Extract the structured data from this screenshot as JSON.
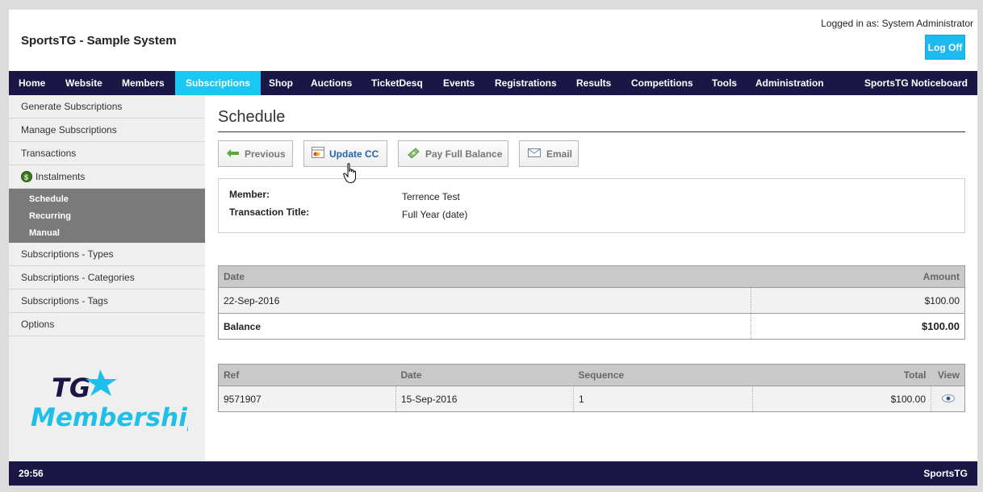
{
  "header": {
    "app_title": "SportsTG - Sample System",
    "logged_in": "Logged in as: System Administrator",
    "logoff_label": "Log Off"
  },
  "nav": {
    "items": [
      "Home",
      "Website",
      "Members",
      "Subscriptions",
      "Shop",
      "Auctions",
      "TicketDesq",
      "Events",
      "Registrations",
      "Results",
      "Competitions",
      "Tools",
      "Administration"
    ],
    "active": "Subscriptions",
    "right": "SportsTG Noticeboard"
  },
  "sidebar": {
    "items": [
      "Generate Subscriptions",
      "Manage Subscriptions",
      "Transactions",
      "Instalments"
    ],
    "sub_items": [
      "Schedule",
      "Recurring",
      "Manual"
    ],
    "items_after": [
      "Subscriptions - Types",
      "Subscriptions - Categories",
      "Subscriptions - Tags",
      "Options"
    ],
    "logo": {
      "line1": "TG",
      "line2": "Membership"
    }
  },
  "main": {
    "title": "Schedule",
    "buttons": {
      "previous": "Previous",
      "update_cc": "Update CC",
      "pay_full_balance": "Pay Full Balance",
      "email": "Email"
    },
    "member": {
      "member_label": "Member:",
      "member_value": "Terrence Test",
      "title_label": "Transaction Title:",
      "title_value": "Full Year (date)"
    },
    "schedule_table": {
      "headers": {
        "date": "Date",
        "amount": "Amount"
      },
      "rows": [
        {
          "date": "22-Sep-2016",
          "amount": "$100.00"
        }
      ],
      "balance_label": "Balance",
      "balance_value": "$100.00"
    },
    "payments_table": {
      "headers": {
        "ref": "Ref",
        "date": "Date",
        "sequence": "Sequence",
        "total": "Total",
        "view": "View"
      },
      "rows": [
        {
          "ref": "9571907",
          "date": "15-Sep-2016",
          "sequence": "1",
          "total": "$100.00"
        }
      ]
    }
  },
  "footer": {
    "timer": "29:56",
    "brand": "SportsTG"
  },
  "colors": {
    "nav_bg": "#1a1747",
    "accent": "#18c7f2",
    "logo_blue": "#1ec0ea"
  }
}
